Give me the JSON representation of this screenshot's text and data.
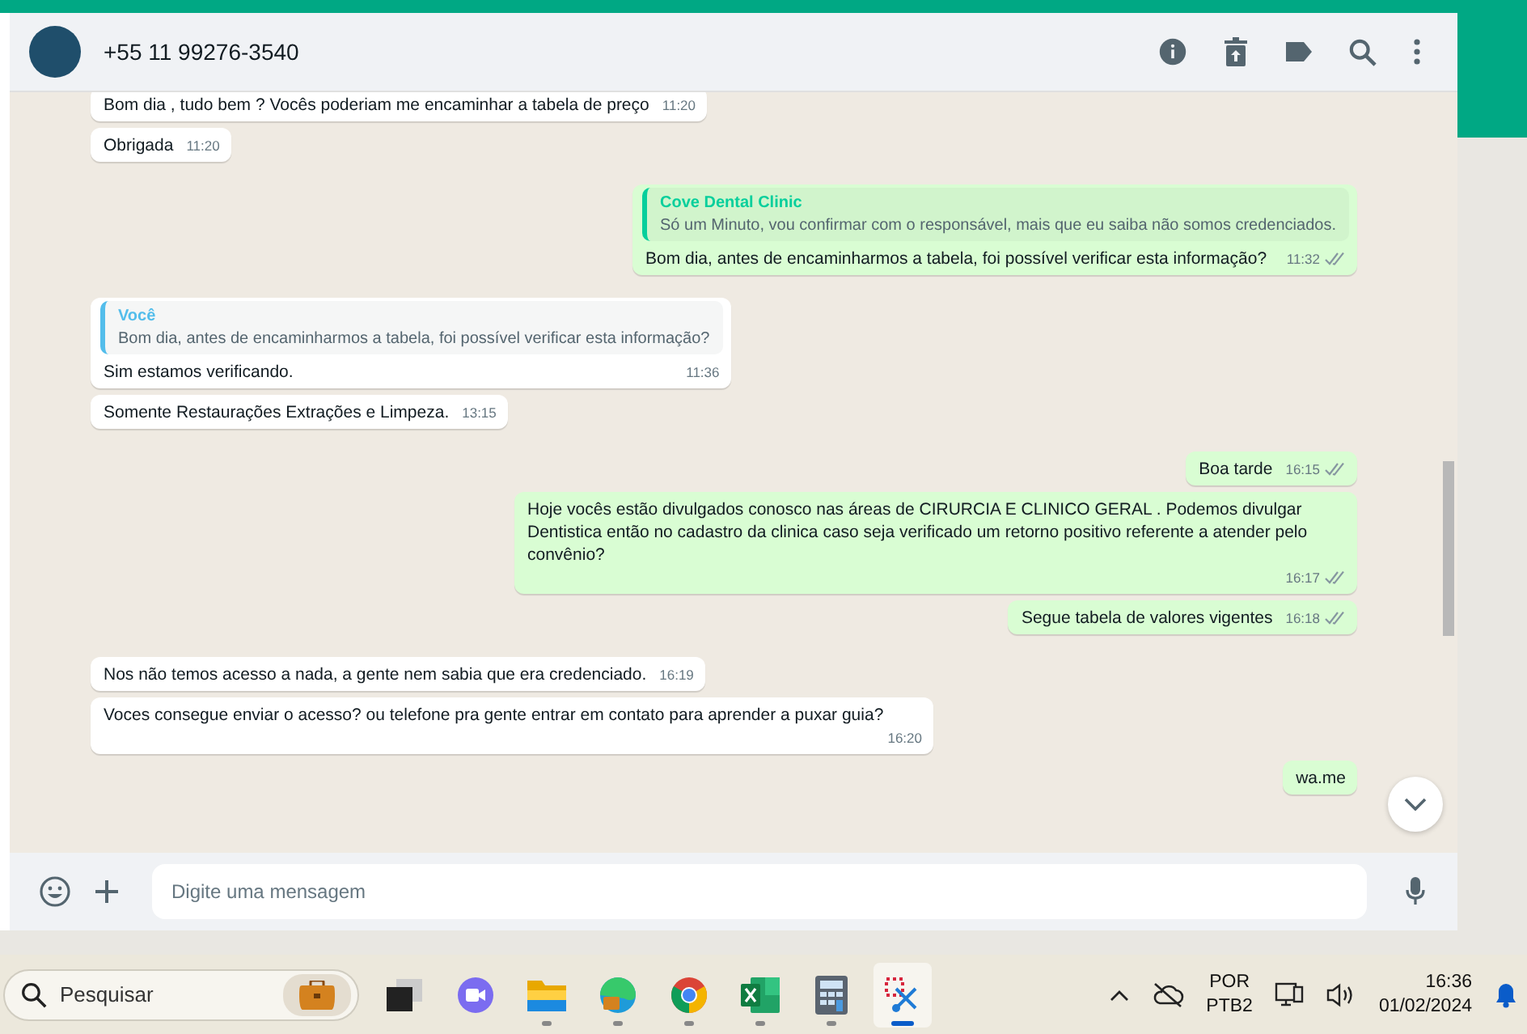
{
  "header": {
    "contact": "+55 11 99276-3540"
  },
  "messages": [
    {
      "kind": "in",
      "text": "Bom dia , tudo bem ? Vocês poderiam me encaminhar a tabela de preço",
      "time": "11:20"
    },
    {
      "kind": "in",
      "text": "Obrigada",
      "time": "11:20"
    },
    {
      "kind": "out",
      "quote": {
        "author": "Cove Dental Clinic",
        "text": "Só um Minuto, vou confirmar com o responsável, mais que eu saiba não somos credenciados."
      },
      "text": "Bom dia, antes de encaminharmos a tabela, foi possível verificar esta informação?",
      "time": "11:32"
    },
    {
      "kind": "in",
      "quote": {
        "author": "Você",
        "text": "Bom dia, antes de encaminharmos a tabela, foi possível verificar esta informação?"
      },
      "text": "Sim estamos verificando.",
      "time": "11:36"
    },
    {
      "kind": "in",
      "text": "Somente Restaurações Extrações e Limpeza.",
      "time": "13:15"
    },
    {
      "kind": "out",
      "text": "Boa tarde",
      "time": "16:15"
    },
    {
      "kind": "out",
      "text": "Hoje vocês estão divulgados conosco nas áreas de CIRURCIA E CLINICO GERAL . Podemos divulgar Dentistica então no cadastro da clinica caso seja verificado um retorno positivo referente a atender pelo convênio?",
      "time": "16:17"
    },
    {
      "kind": "out",
      "text": "Segue tabela de valores vigentes",
      "time": "16:18"
    },
    {
      "kind": "in",
      "text": "Nos não temos acesso a nada, a gente nem sabia que era credenciado.",
      "time": "16:19"
    },
    {
      "kind": "in",
      "text": "Voces consegue enviar o acesso? ou telefone pra gente entrar em contato para aprender a  puxar guia?",
      "time": "16:20"
    },
    {
      "kind": "out",
      "text": "wa.me"
    }
  ],
  "composer": {
    "placeholder": "Digite uma mensagem"
  },
  "taskbar": {
    "search_placeholder": "Pesquisar",
    "apps": [
      {
        "kind": "taskview",
        "running": false,
        "selected": false
      },
      {
        "kind": "meet",
        "running": false,
        "selected": false
      },
      {
        "kind": "folder",
        "running": true,
        "selected": false
      },
      {
        "kind": "edge",
        "running": true,
        "selected": false
      },
      {
        "kind": "chrome",
        "running": true,
        "selected": false
      },
      {
        "kind": "excel",
        "running": true,
        "selected": false
      },
      {
        "kind": "calculator",
        "running": true,
        "selected": false
      },
      {
        "kind": "snip",
        "running": true,
        "selected": true
      }
    ],
    "language": "POR",
    "layout": "PTB2",
    "time": "16:36",
    "date": "01/02/2024"
  }
}
